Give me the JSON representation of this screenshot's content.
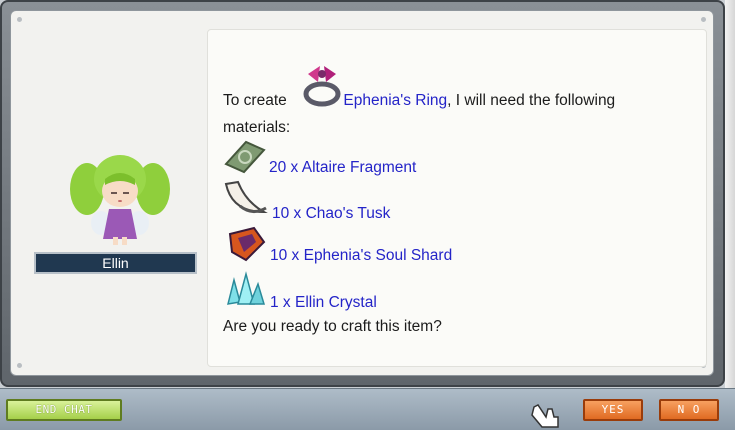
{
  "npc": {
    "name": "Ellin"
  },
  "dialog": {
    "prefix": "To create",
    "target_item": "Ephenia's Ring",
    "suffix": ", I will need the following",
    "line2": "materials:",
    "materials": [
      {
        "text": "20 x Altaire Fragment",
        "icon": "altaire-fragment-icon"
      },
      {
        "text": "10 x Chao's Tusk",
        "icon": "chaos-tusk-icon"
      },
      {
        "text": "10 x Ephenia's Soul Shard",
        "icon": "soul-shard-icon"
      },
      {
        "text": "1 x Ellin Crystal",
        "icon": "ellin-crystal-icon"
      }
    ],
    "question": "Are you ready to craft this item?"
  },
  "buttons": {
    "end_chat": "END CHAT",
    "yes": "YES",
    "no": "N O"
  },
  "colors": {
    "link": "#2424c8",
    "end_chat": "#a5cf4a",
    "confirm": "#e06a22",
    "name_bg": "#203850"
  }
}
